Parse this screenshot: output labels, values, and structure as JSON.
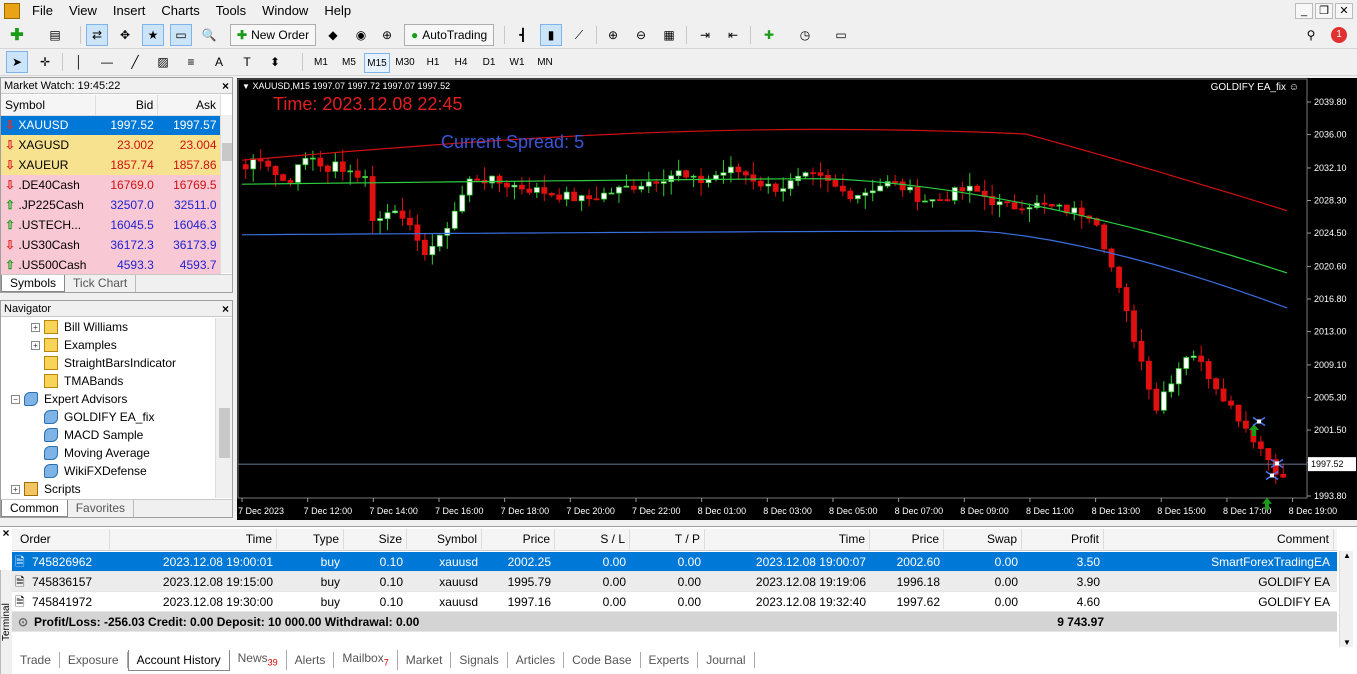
{
  "menu": [
    "File",
    "View",
    "Insert",
    "Charts",
    "Tools",
    "Window",
    "Help"
  ],
  "toolbar": {
    "new_order": "New Order",
    "auto_trading": "AutoTrading",
    "timeframes": [
      "M1",
      "M5",
      "M15",
      "M30",
      "H1",
      "H4",
      "D1",
      "W1",
      "MN"
    ],
    "selected_timeframe": "M15",
    "notification_count": "1"
  },
  "market_watch": {
    "title": "Market Watch: 19:45:22",
    "columns": [
      "Symbol",
      "Bid",
      "Ask"
    ],
    "rows": [
      {
        "symbol": "XAUUSD",
        "bid": "1997.52",
        "ask": "1997.57",
        "dir": "down",
        "bg": "#0078d7"
      },
      {
        "symbol": "XAGUSD",
        "bid": "23.002",
        "ask": "23.004",
        "dir": "down",
        "bg": "#f7e28f"
      },
      {
        "symbol": "XAUEUR",
        "bid": "1857.74",
        "ask": "1857.86",
        "dir": "down",
        "bg": "#f7e28f"
      },
      {
        "symbol": ".DE40Cash",
        "bid": "16769.0",
        "ask": "16769.5",
        "dir": "down",
        "bg": "#f8c8d4"
      },
      {
        "symbol": ".JP225Cash",
        "bid": "32507.0",
        "ask": "32511.0",
        "dir": "up",
        "bg": "#f8c8d4"
      },
      {
        "symbol": ".USTECH...",
        "bid": "16045.5",
        "ask": "16046.3",
        "dir": "up",
        "bg": "#f8c8d4"
      },
      {
        "symbol": ".US30Cash",
        "bid": "36172.3",
        "ask": "36173.9",
        "dir": "down",
        "bg": "#f8c8d4"
      },
      {
        "symbol": ".US500Cash",
        "bid": "4593.3",
        "ask": "4593.7",
        "dir": "up",
        "bg": "#f8c8d4"
      }
    ],
    "tabs": [
      "Symbols",
      "Tick Chart"
    ]
  },
  "navigator": {
    "title": "Navigator",
    "items": [
      {
        "label": "Bill Williams",
        "type": "book",
        "level": 2,
        "exp": "+"
      },
      {
        "label": "Examples",
        "type": "book",
        "level": 2,
        "exp": "+"
      },
      {
        "label": "StraightBarsIndicator",
        "type": "book",
        "level": 2,
        "exp": ""
      },
      {
        "label": "TMABands",
        "type": "book",
        "level": 2,
        "exp": ""
      },
      {
        "label": "Expert Advisors",
        "type": "ea",
        "level": 1,
        "exp": "−"
      },
      {
        "label": "GOLDIFY EA_fix",
        "type": "ea",
        "level": 2,
        "exp": ""
      },
      {
        "label": "MACD Sample",
        "type": "ea",
        "level": 2,
        "exp": ""
      },
      {
        "label": "Moving Average",
        "type": "ea",
        "level": 2,
        "exp": ""
      },
      {
        "label": "WikiFXDefense",
        "type": "ea",
        "level": 2,
        "exp": ""
      },
      {
        "label": "Scripts",
        "type": "script",
        "level": 1,
        "exp": "+"
      }
    ],
    "tabs": [
      "Common",
      "Favorites"
    ]
  },
  "chart": {
    "header": "XAUUSD,M15  1997.07 1997.72 1997.07 1997.52",
    "ea_label": "GOLDIFY EA_fix",
    "time_label": "Time: 2023.12.08 22:45",
    "spread_label": "Current Spread: 5",
    "current_price": "1997.52",
    "price_ticks": [
      "2039.80",
      "2036.00",
      "2032.10",
      "2028.30",
      "2024.50",
      "2020.60",
      "2016.80",
      "2013.00",
      "2009.10",
      "2005.30",
      "2001.50",
      "1997.70",
      "1993.80"
    ],
    "time_ticks": [
      "7 Dec 2023",
      "7 Dec 12:00",
      "7 Dec 14:00",
      "7 Dec 16:00",
      "7 Dec 18:00",
      "7 Dec 20:00",
      "7 Dec 22:00",
      "8 Dec 01:00",
      "8 Dec 03:00",
      "8 Dec 05:00",
      "8 Dec 07:00",
      "8 Dec 09:00",
      "8 Dec 11:00",
      "8 Dec 13:00",
      "8 Dec 15:00",
      "8 Dec 17:00",
      "8 Dec 19:00"
    ],
    "colors": {
      "up": "#ffffff",
      "down": "#e01010",
      "up_wick": "#32cd32",
      "ma_red": "#d01010",
      "ma_green": "#2ecc40",
      "ma_blue": "#3a6fe0"
    }
  },
  "terminal": {
    "label": "Terminal",
    "columns": [
      "Order",
      "Time",
      "Type",
      "Size",
      "Symbol",
      "Price",
      "S / L",
      "T / P",
      "Time",
      "Price",
      "Swap",
      "Profit",
      "Comment"
    ],
    "rows": [
      {
        "order": "745826962",
        "time": "2023.12.08 19:00:01",
        "type": "buy",
        "size": "0.10",
        "symbol": "xauusd",
        "price": "2002.25",
        "sl": "0.00",
        "tp": "0.00",
        "ctime": "2023.12.08 19:00:07",
        "cprice": "2002.60",
        "swap": "0.00",
        "profit": "3.50",
        "comment": "SmartForexTradingEA"
      },
      {
        "order": "745836157",
        "time": "2023.12.08 19:15:00",
        "type": "buy",
        "size": "0.10",
        "symbol": "xauusd",
        "price": "1995.79",
        "sl": "0.00",
        "tp": "0.00",
        "ctime": "2023.12.08 19:19:06",
        "cprice": "1996.18",
        "swap": "0.00",
        "profit": "3.90",
        "comment": "GOLDIFY EA"
      },
      {
        "order": "745841972",
        "time": "2023.12.08 19:30:00",
        "type": "buy",
        "size": "0.10",
        "symbol": "xauusd",
        "price": "1997.16",
        "sl": "0.00",
        "tp": "0.00",
        "ctime": "2023.12.08 19:32:40",
        "cprice": "1997.62",
        "swap": "0.00",
        "profit": "4.60",
        "comment": "GOLDIFY EA"
      }
    ],
    "summary": "Profit/Loss: -256.03  Credit: 0.00  Deposit: 10 000.00  Withdrawal: 0.00",
    "summary_total": "9 743.97",
    "tabs": [
      {
        "label": "Trade",
        "badge": ""
      },
      {
        "label": "Exposure",
        "badge": ""
      },
      {
        "label": "Account History",
        "badge": "",
        "active": true
      },
      {
        "label": "News",
        "badge": "39"
      },
      {
        "label": "Alerts",
        "badge": ""
      },
      {
        "label": "Mailbox",
        "badge": "7"
      },
      {
        "label": "Market",
        "badge": ""
      },
      {
        "label": "Signals",
        "badge": ""
      },
      {
        "label": "Articles",
        "badge": ""
      },
      {
        "label": "Code Base",
        "badge": ""
      },
      {
        "label": "Experts",
        "badge": ""
      },
      {
        "label": "Journal",
        "badge": ""
      }
    ]
  }
}
